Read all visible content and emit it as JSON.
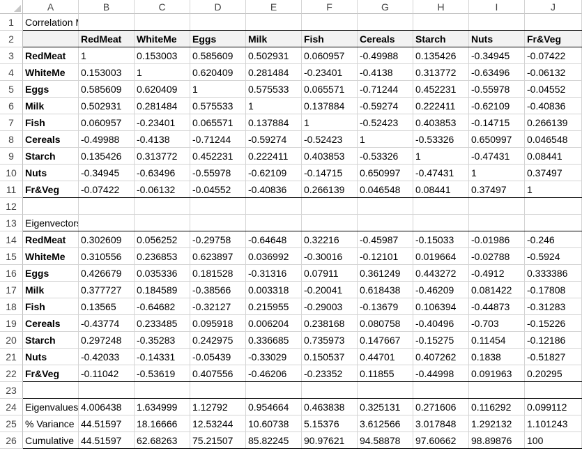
{
  "columns": [
    "A",
    "B",
    "C",
    "D",
    "E",
    "F",
    "G",
    "H",
    "I",
    "J"
  ],
  "rows": [
    "1",
    "2",
    "3",
    "4",
    "5",
    "6",
    "7",
    "8",
    "9",
    "10",
    "11",
    "12",
    "13",
    "14",
    "15",
    "16",
    "17",
    "18",
    "19",
    "20",
    "21",
    "22",
    "23",
    "24",
    "25",
    "26"
  ],
  "correlation": {
    "title": "Correlation Matrix",
    "headers": [
      "RedMeat",
      "WhiteMe",
      "Eggs",
      "Milk",
      "Fish",
      "Cereals",
      "Starch",
      "Nuts",
      "Fr&Veg"
    ],
    "rows": [
      {
        "label": "RedMeat",
        "values": [
          "1",
          "0.153003",
          "0.585609",
          "0.502931",
          "0.060957",
          "-0.49988",
          "0.135426",
          "-0.34945",
          "-0.07422"
        ]
      },
      {
        "label": "WhiteMe",
        "values": [
          "0.153003",
          "1",
          "0.620409",
          "0.281484",
          "-0.23401",
          "-0.4138",
          "0.313772",
          "-0.63496",
          "-0.06132"
        ]
      },
      {
        "label": "Eggs",
        "values": [
          "0.585609",
          "0.620409",
          "1",
          "0.575533",
          "0.065571",
          "-0.71244",
          "0.452231",
          "-0.55978",
          "-0.04552"
        ]
      },
      {
        "label": "Milk",
        "values": [
          "0.502931",
          "0.281484",
          "0.575533",
          "1",
          "0.137884",
          "-0.59274",
          "0.222411",
          "-0.62109",
          "-0.40836"
        ]
      },
      {
        "label": "Fish",
        "values": [
          "0.060957",
          "-0.23401",
          "0.065571",
          "0.137884",
          "1",
          "-0.52423",
          "0.403853",
          "-0.14715",
          "0.266139"
        ]
      },
      {
        "label": "Cereals",
        "values": [
          "-0.49988",
          "-0.4138",
          "-0.71244",
          "-0.59274",
          "-0.52423",
          "1",
          "-0.53326",
          "0.650997",
          "0.046548"
        ]
      },
      {
        "label": "Starch",
        "values": [
          "0.135426",
          "0.313772",
          "0.452231",
          "0.222411",
          "0.403853",
          "-0.53326",
          "1",
          "-0.47431",
          "0.08441"
        ]
      },
      {
        "label": "Nuts",
        "values": [
          "-0.34945",
          "-0.63496",
          "-0.55978",
          "-0.62109",
          "-0.14715",
          "0.650997",
          "-0.47431",
          "1",
          "0.37497"
        ]
      },
      {
        "label": "Fr&Veg",
        "values": [
          "-0.07422",
          "-0.06132",
          "-0.04552",
          "-0.40836",
          "0.266139",
          "0.046548",
          "0.08441",
          "0.37497",
          "1"
        ]
      }
    ]
  },
  "eigen": {
    "title": "Eigenvectors",
    "rows": [
      {
        "label": "RedMeat",
        "values": [
          "0.302609",
          "0.056252",
          "-0.29758",
          "-0.64648",
          "0.32216",
          "-0.45987",
          "-0.15033",
          "-0.01986",
          "-0.246"
        ]
      },
      {
        "label": "WhiteMe",
        "values": [
          "0.310556",
          "0.236853",
          "0.623897",
          "0.036992",
          "-0.30016",
          "-0.12101",
          "0.019664",
          "-0.02788",
          "-0.5924"
        ]
      },
      {
        "label": "Eggs",
        "values": [
          "0.426679",
          "0.035336",
          "0.181528",
          "-0.31316",
          "0.07911",
          "0.361249",
          "0.443272",
          "-0.4912",
          "0.333386"
        ]
      },
      {
        "label": "Milk",
        "values": [
          "0.377727",
          "0.184589",
          "-0.38566",
          "0.003318",
          "-0.20041",
          "0.618438",
          "-0.46209",
          "0.081422",
          "-0.17808"
        ]
      },
      {
        "label": "Fish",
        "values": [
          "0.13565",
          "-0.64682",
          "-0.32127",
          "0.215955",
          "-0.29003",
          "-0.13679",
          "0.106394",
          "-0.44873",
          "-0.31283"
        ]
      },
      {
        "label": "Cereals",
        "values": [
          "-0.43774",
          "0.233485",
          "0.095918",
          "0.006204",
          "0.238168",
          "0.080758",
          "-0.40496",
          "-0.703",
          "-0.15226"
        ]
      },
      {
        "label": "Starch",
        "values": [
          "0.297248",
          "-0.35283",
          "0.242975",
          "0.336685",
          "0.735973",
          "0.147667",
          "-0.15275",
          "0.11454",
          "-0.12186"
        ]
      },
      {
        "label": "Nuts",
        "values": [
          "-0.42033",
          "-0.14331",
          "-0.05439",
          "-0.33029",
          "0.150537",
          "0.44701",
          "0.407262",
          "0.1838",
          "-0.51827"
        ]
      },
      {
        "label": "Fr&Veg",
        "values": [
          "-0.11042",
          "-0.53619",
          "0.407556",
          "-0.46206",
          "-0.23352",
          "0.11855",
          "-0.44998",
          "0.091963",
          "0.20295"
        ]
      }
    ]
  },
  "summary": {
    "rows": [
      {
        "label": "Eigenvalues",
        "values": [
          "4.006438",
          "1.634999",
          "1.12792",
          "0.954664",
          "0.463838",
          "0.325131",
          "0.271606",
          "0.116292",
          "0.099112"
        ]
      },
      {
        "label": "% Variance",
        "values": [
          "44.51597",
          "18.16666",
          "12.53244",
          "10.60738",
          "5.15376",
          "3.612566",
          "3.017848",
          "1.292132",
          "1.101243"
        ]
      },
      {
        "label": "Cumulative",
        "values": [
          "44.51597",
          "62.68263",
          "75.21507",
          "85.82245",
          "90.97621",
          "94.58878",
          "97.60662",
          "98.89876",
          "100"
        ]
      }
    ]
  }
}
